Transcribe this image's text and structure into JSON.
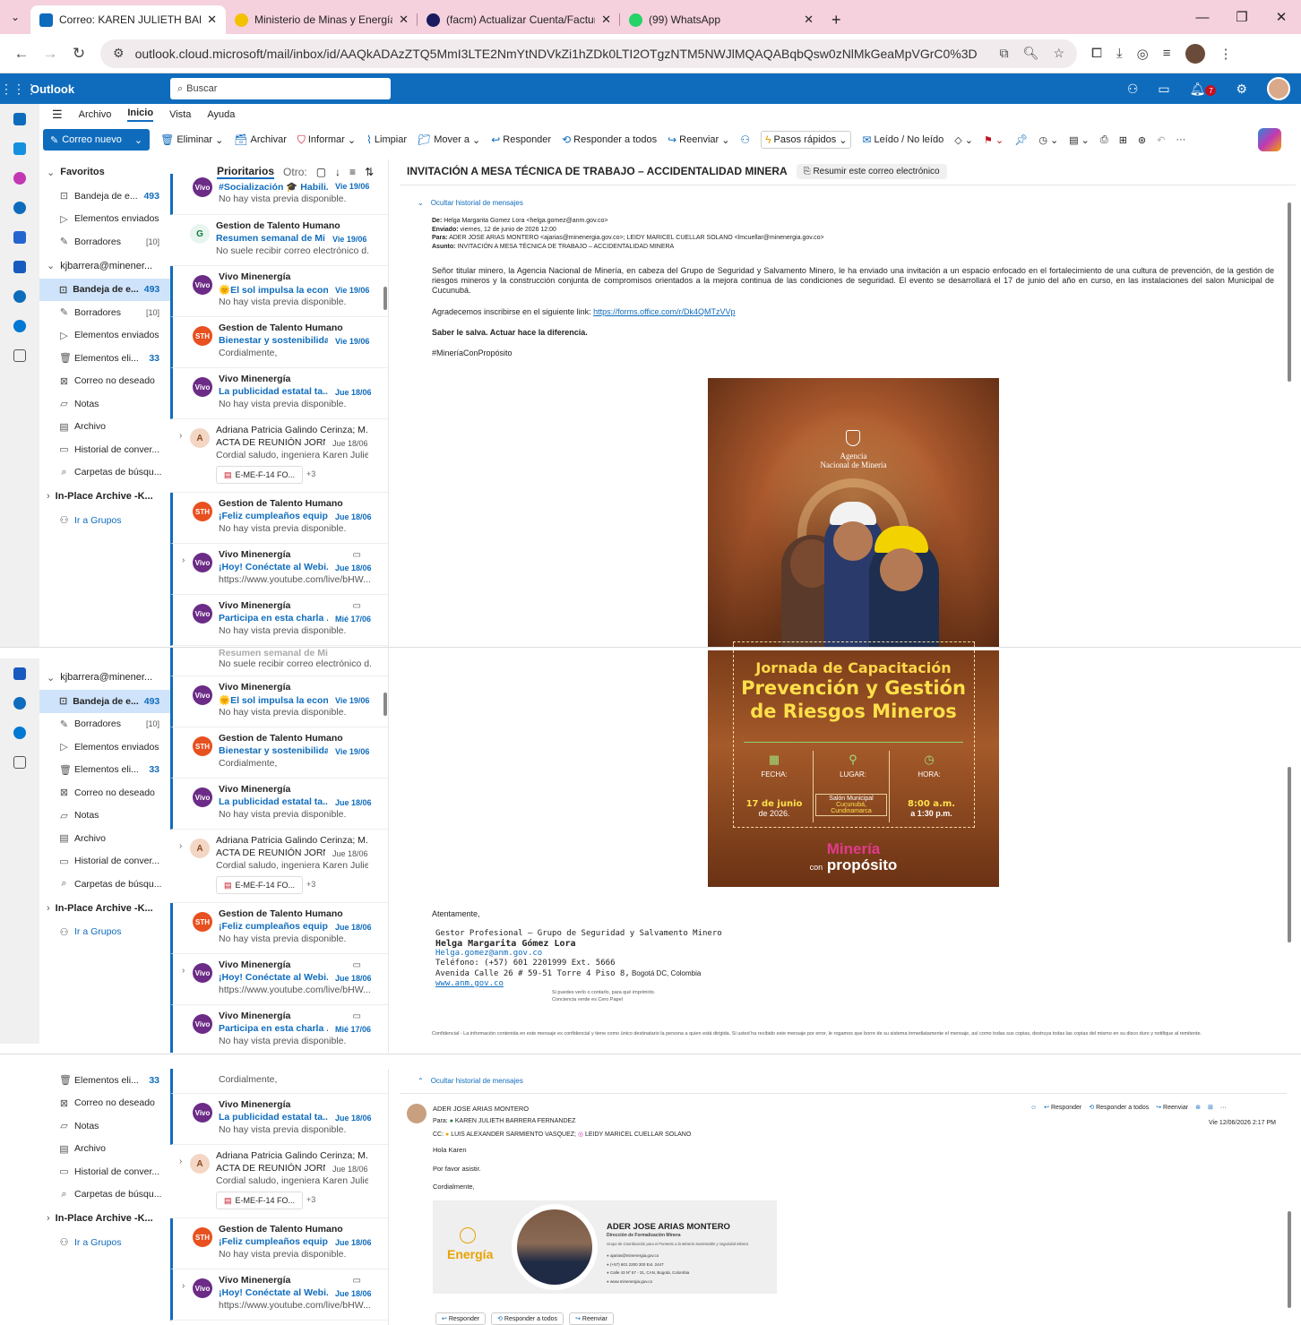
{
  "browser": {
    "tabs": [
      {
        "title": "Correo: KAREN JULIETH BARRE",
        "active": true
      },
      {
        "title": "Ministerio de Minas y Energía"
      },
      {
        "title": "(facm) Actualizar Cuenta/Factur"
      },
      {
        "title": "(99) WhatsApp"
      }
    ],
    "url": "outlook.cloud.microsoft/mail/inbox/id/AAQkADAzZTQ5MmI3LTE2NmYtNDVkZi1hZDk0LTI2OTgzNTM5NWJlMQAQABqbQsw0zNlMkGeaMpVGrC0%3D"
  },
  "outlook": {
    "brand": "Outlook",
    "search_placeholder": "Buscar",
    "notif_count": "7",
    "menu_tabs": [
      "Archivo",
      "Inicio",
      "Vista",
      "Ayuda"
    ],
    "toolbar": {
      "new_mail": "Correo nuevo",
      "delete": "Eliminar",
      "archive": "Archivar",
      "report": "Informar",
      "clean": "Limpiar",
      "move": "Mover a",
      "reply": "Responder",
      "reply_all": "Responder a todos",
      "forward": "Reenviar",
      "quick_steps": "Pasos rápidos",
      "read_unread": "Leído / No leído"
    }
  },
  "folders": {
    "favorites": "Favoritos",
    "account": "kjbarrera@minener...",
    "archive_group": "In-Place Archive -K...",
    "groups": "Ir a Grupos",
    "fav_items": [
      {
        "label": "Bandeja de e...",
        "count": "493"
      },
      {
        "label": "Elementos enviados"
      },
      {
        "label": "Borradores",
        "count": "[10]"
      }
    ],
    "account_items": [
      {
        "label": "Bandeja de e...",
        "count": "493"
      },
      {
        "label": "Borradores",
        "count": "[10]"
      },
      {
        "label": "Elementos enviados"
      },
      {
        "label": "Elementos eli...",
        "count": "33"
      },
      {
        "label": "Correo no deseado"
      },
      {
        "label": "Notas"
      },
      {
        "label": "Archivo"
      },
      {
        "label": "Historial de conver..."
      },
      {
        "label": "Carpetas de búsqu..."
      }
    ]
  },
  "list": {
    "focused": "Prioritarios",
    "other": "Otro:",
    "messages": [
      {
        "sender": "",
        "subject": "#Socialización 🎓 Habili...",
        "date": "Vie 19/06",
        "preview": "No hay vista previa disponible.",
        "av": "vivo"
      },
      {
        "sender": "Gestion de Talento Humano",
        "subject": "Resumen semanal de Mi...",
        "date": "Vie 19/06",
        "preview": "No suele recibir correo electrónico d...",
        "av": "G"
      },
      {
        "sender": "Vivo Minenergía",
        "subject": "🌞El sol impulsa la econ...",
        "date": "Vie 19/06",
        "preview": "No hay vista previa disponible.",
        "av": "vivo"
      },
      {
        "sender": "Gestion de Talento Humano",
        "subject": "Bienestar y sostenibilida...",
        "date": "Vie 19/06",
        "preview": "Cordialmente,",
        "av": "STH"
      },
      {
        "sender": "Vivo Minenergía",
        "subject": "La publicidad estatal ta...",
        "date": "Jue 18/06",
        "preview": "No hay vista previa disponible.",
        "av": "vivo"
      },
      {
        "sender": "Adriana Patricia Galindo Cerinza; M...",
        "subject": "ACTA DE REUNIÓN JORN...",
        "date": "Jue 18/06",
        "preview": "Cordial saludo, ingeniera Karen Julie...",
        "av": "A",
        "attach": "E-ME-F-14 FO...",
        "more": "+3"
      },
      {
        "sender": "Gestion de Talento Humano",
        "subject": "¡Feliz cumpleaños equip...",
        "date": "Jue 18/06",
        "preview": "No hay vista previa disponible.",
        "av": "STH"
      },
      {
        "sender": "Vivo Minenergía",
        "subject": "¡Hoy! Conéctate al Webi...",
        "date": "Jue 18/06",
        "preview": "https://www.youtube.com/live/bHW...",
        "av": "vivo"
      },
      {
        "sender": "Vivo Minenergía",
        "subject": "Participa en esta charla ...",
        "date": "Mié 17/06",
        "preview": "No hay vista previa disponible.",
        "av": "vivo"
      }
    ],
    "partial_subject": "Resumen semanal de Mi...",
    "partial_preview": "No suele recibir correo electrónico d..."
  },
  "email": {
    "title": "INVITACIÓN A MESA TÉCNICA DE TRABAJO – ACCIDENTALIDAD MINERA",
    "summarize": "Resumir este correo electrónico",
    "hide_history": "Ocultar historial de mensajes",
    "meta": {
      "from_label": "De:",
      "from": "Helga Margarita Gomez Lora <helga.gomez@anm.gov.co>",
      "sent_label": "Enviado:",
      "sent": "viernes, 12 de junio de 2026 12:00",
      "to_label": "Para:",
      "to": "ADER JOSE ARIAS MONTERO <ajarias@minenergia.gov.co>; LEIDY MARICEL CUELLAR SOLANO <lmcuellar@minenergia.gov.co>",
      "subject_label": "Asunto:",
      "subject": "INVITACIÓN A MESA TÉCNICA DE TRABAJO – ACCIDENTALIDAD MINERA"
    },
    "paragraph1": "Señor titular minero, la Agencia Nacional de Minería, en cabeza del Grupo de Seguridad y Salvamento Minero, le ha enviado una invitación a un espacio enfocado en el fortalecimiento de una cultura de prevención, de la gestión de riesgos mineros y la construcción conjunta de compromisos orientados a la mejora continua de las condiciones de seguridad. El evento se desarrollará el 17 de junio del año en curso, en las instalaciones del salon Municipal de Cucunubá.",
    "register_text": "Agradecemos inscribirse en el siguiente link: ",
    "register_link": "https://forms.office.com/r/Dk4QMTzVVp",
    "motto": "Saber le salva. Actuar hace la diferencia.",
    "hashtag": "#MineríaConPropósito",
    "poster": {
      "agency_line1": "Agencia",
      "agency_line2": "Nacional de Minería",
      "title1": "Jornada de Capacitación",
      "title2": "Prevención y Gestión",
      "title3": "de Riesgos Mineros",
      "fecha": "FECHA:",
      "lugar": "LUGAR:",
      "hora": "HORA:",
      "date1": "17 de junio",
      "date2": "de 2026.",
      "place1": "Salón Municipal",
      "place2": "Cucunubá,",
      "place3": "Cundinamarca",
      "time1": "8:00 a.m.",
      "time2": "a 1:30 p.m.",
      "brand1": "Minería",
      "brand2": "con",
      "brand3": "propósito"
    },
    "closing": "Atentamente,",
    "signature": {
      "role": "Gestor Profesional – Grupo de Seguridad y Salvamento Minero",
      "name": "Helga Margarita Gómez Lora",
      "email": "Helga.gomez@anm.gov.co",
      "phone": "Teléfono: (+57) 601 2201999 Ext. 5666",
      "address": "Avenida Calle 26 # 59-51 Torre 4 Piso 8,",
      "city": " Bogotá DC, Colombia",
      "web": "www.anm.gov.co",
      "green1": "Si puedes verlo o contarlo, para qué imprimirlo.",
      "green2": "Conciencia verde es Cero Papel"
    },
    "confidential": "Confidencial - La información contenida en este mensaje es confidencial y tiene como único destinatario la persona a quien está dirigida. Si usted ha recibido este mensaje por error, le rogamos que borre de su sistema inmediatamente el mensaje, así como todas sus copias, destruya todas las copias del mismo en su disco duro y notifique al remitente."
  },
  "reply": {
    "from": "ADER JOSE ARIAS MONTERO",
    "to_label": "Para:",
    "to": "KAREN JULIETH BARRERA FERNANDEZ",
    "cc_label": "CC:",
    "cc1": "LUIS ALEXANDER SARMIENTO VASQUEZ;",
    "cc2": "LEIDY MARICEL CUELLAR SOLANO",
    "date": "Vie 12/06/2026 2:17 PM",
    "greeting": "Hola Karen",
    "body": "Por favor asistir.",
    "closing": "Cordialmente,",
    "actions": {
      "reply": "Responder",
      "reply_all": "Responder a todos",
      "forward": "Reenviar"
    },
    "card": {
      "brand": "Energía",
      "name": "ADER JOSE ARIAS MONTERO",
      "dept": "Dirección de Formalización Minera",
      "group": "Grupo de Coordinación para el Fomento a la Minería Sustentable y seguridad Minera",
      "email": "ajarias@minenergia.gov.co",
      "phone": "(+57) 601 2200 300 Ext. 2447",
      "address": "Calle 43 Nº 57 - 31, CAN, Bogotá, Colombia",
      "web": "www.minenergia.gov.co"
    }
  }
}
